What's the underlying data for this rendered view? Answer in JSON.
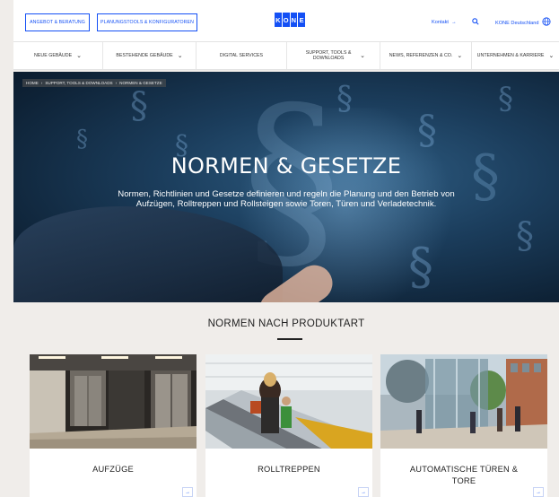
{
  "header": {
    "btn_offer": "ANGEBOT & BERATUNG",
    "btn_tools": "PLANUNGSTOOLS & KONFIGURATOREN",
    "logo_letters": [
      "K",
      "O",
      "N",
      "E"
    ],
    "contact_label": "Kontakt",
    "country_label": "KONE Deutschland",
    "brand_color": "#1450f5"
  },
  "nav": {
    "items": [
      {
        "label": "NEUE GEBÄUDE",
        "dropdown": true
      },
      {
        "label": "BESTEHENDE GEBÄUDE",
        "dropdown": true
      },
      {
        "label": "DIGITAL SERVICES",
        "dropdown": false
      },
      {
        "label": "SUPPORT, TOOLS & DOWNLOADS",
        "dropdown": true
      },
      {
        "label": "NEWS, REFERENZEN & CO.",
        "dropdown": true
      },
      {
        "label": "UNTERNEHMEN & KARRIERE",
        "dropdown": true
      }
    ]
  },
  "hero": {
    "breadcrumb": [
      "HOME",
      "SUPPORT, TOOLS & DOWNLOADS",
      "NORMEN & GESETZE"
    ],
    "title": "NORMEN & GESETZE",
    "text": "Normen, Richtlinien und Gesetze definieren und regeln die Planung und den Betrieb von Aufzügen, Rolltreppen und Rollsteigen sowie Toren, Türen und Verladetechnik."
  },
  "section": {
    "title": "NORMEN NACH PRODUKTART"
  },
  "cards": [
    {
      "label": "AUFZÜGE"
    },
    {
      "label": "ROLLTREPPEN"
    },
    {
      "label": "AUTOMATISCHE TÜREN & TORE"
    }
  ],
  "icons": {
    "arrow": "→",
    "search": "search-icon",
    "globe": "globe-icon",
    "chevron": "chevron-down-icon"
  }
}
